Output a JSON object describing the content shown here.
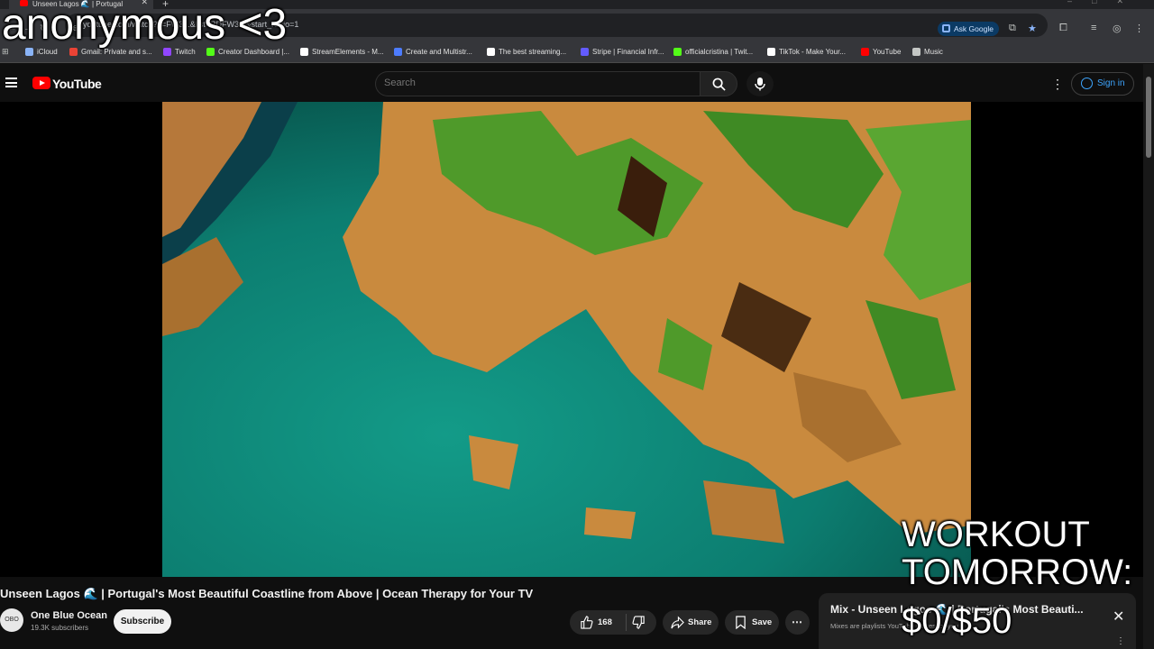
{
  "browser": {
    "tab_title": "Unseen Lagos 🌊 | Portugal",
    "url": "youtube.com/watch?v=FW3...&list=RDFW3...&start_radio=1",
    "ask_google_label": "Ask Google",
    "bookmarks": [
      {
        "label": "iCloud",
        "color": "#8ab4f8"
      },
      {
        "label": "Gmail: Private and s...",
        "color": "#ea4335"
      },
      {
        "label": "Twitch",
        "color": "#9146ff"
      },
      {
        "label": "Creator Dashboard |...",
        "color": "#53fc18"
      },
      {
        "label": "StreamElements - M...",
        "color": "#ffffff"
      },
      {
        "label": "Create and Multistr...",
        "color": "#4d7cfe"
      },
      {
        "label": "The best streaming...",
        "color": "#ffffff"
      },
      {
        "label": "Stripe | Financial Infr...",
        "color": "#635bff"
      },
      {
        "label": "officialcristina | Twit...",
        "color": "#53fc18"
      },
      {
        "label": "TikTok - Make Your...",
        "color": "#ffffff"
      },
      {
        "label": "YouTube",
        "color": "#ff0000"
      },
      {
        "label": "Music",
        "color": "#c4c7c5"
      }
    ]
  },
  "youtube": {
    "logo_text": "YouTube",
    "search_placeholder": "Search",
    "sign_in_label": "Sign in"
  },
  "video": {
    "title": "Unseen Lagos 🌊 | Portugal's Most Beautiful Coastline from Above | Ocean Therapy for Your TV",
    "channel_name": "One Blue Ocean",
    "subscriber_count": "19.3K subscribers",
    "avatar_text": "OBO",
    "subscribe_label": "Subscribe",
    "like_count": "168",
    "share_label": "Share",
    "save_label": "Save"
  },
  "mix": {
    "title": "Mix - Unseen Lagos 🌊 | Portugal's Most Beauti...",
    "subtitle": "Mixes are playlists YouTube makes for you"
  },
  "overlays": {
    "top_left": "anonymous <3",
    "goal_line1": "WORKOUT",
    "goal_line2": "TOMORROW:",
    "goal_amount": "$0/$50"
  },
  "colors": {
    "youtube_red": "#ff0000",
    "link_blue": "#3ea6ff",
    "water": "#0e8a7a",
    "cliff": "#c98a3e",
    "vegetation": "#4f9a2a"
  }
}
